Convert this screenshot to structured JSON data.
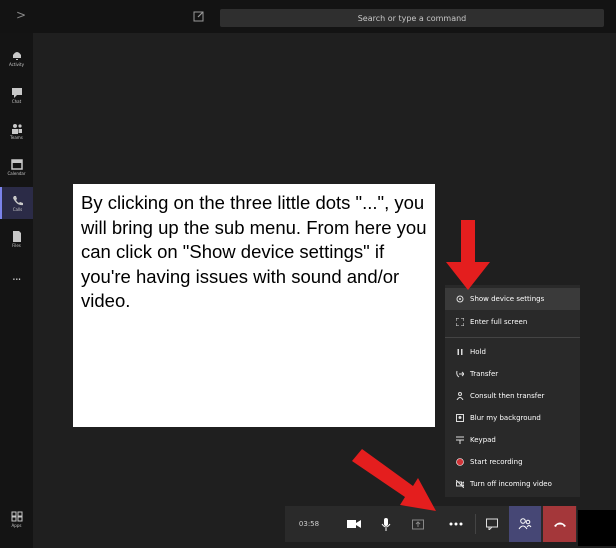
{
  "topbar": {
    "search_placeholder": "Search or type a command",
    "chevron": ">",
    "compose_icon": "compose-icon"
  },
  "rail": {
    "items": [
      {
        "label": "Activity",
        "icon": "bell-icon"
      },
      {
        "label": "Chat",
        "icon": "chat-icon"
      },
      {
        "label": "Teams",
        "icon": "teams-icon"
      },
      {
        "label": "Calendar",
        "icon": "calendar-icon"
      },
      {
        "label": "Calls",
        "icon": "phone-icon",
        "active": true
      },
      {
        "label": "Files",
        "icon": "files-icon"
      }
    ],
    "more": "...",
    "bottom_item": {
      "label": "Apps",
      "icon": "apps-icon"
    }
  },
  "callout": {
    "text": "By clicking on the three little dots \"...\", you will bring up the sub menu. From here you can click on \"Show device settings\" if you're having issues with sound and/or video."
  },
  "menu": {
    "items": [
      {
        "label": "Show device settings",
        "icon": "gear-icon",
        "highlighted": true
      },
      {
        "label": "Enter full screen",
        "icon": "fullscreen-icon"
      },
      {
        "label": "Hold",
        "icon": "pause-icon"
      },
      {
        "label": "Transfer",
        "icon": "transfer-icon"
      },
      {
        "label": "Consult then transfer",
        "icon": "consult-transfer-icon"
      },
      {
        "label": "Blur my background",
        "icon": "blur-icon"
      },
      {
        "label": "Keypad",
        "icon": "keypad-icon"
      },
      {
        "label": "Start recording",
        "icon": "record-icon"
      },
      {
        "label": "Turn off incoming video",
        "icon": "video-off-icon"
      }
    ]
  },
  "controls": {
    "timer": "03:58",
    "buttons": [
      "camera-icon",
      "mic-icon",
      "share-icon",
      "more-icon",
      "chat-icon",
      "people-icon",
      "hangup-icon"
    ]
  },
  "colors": {
    "accent": "#464775",
    "hangup": "#a4373a",
    "arrow": "#e41e1e",
    "record": "#d13438"
  }
}
